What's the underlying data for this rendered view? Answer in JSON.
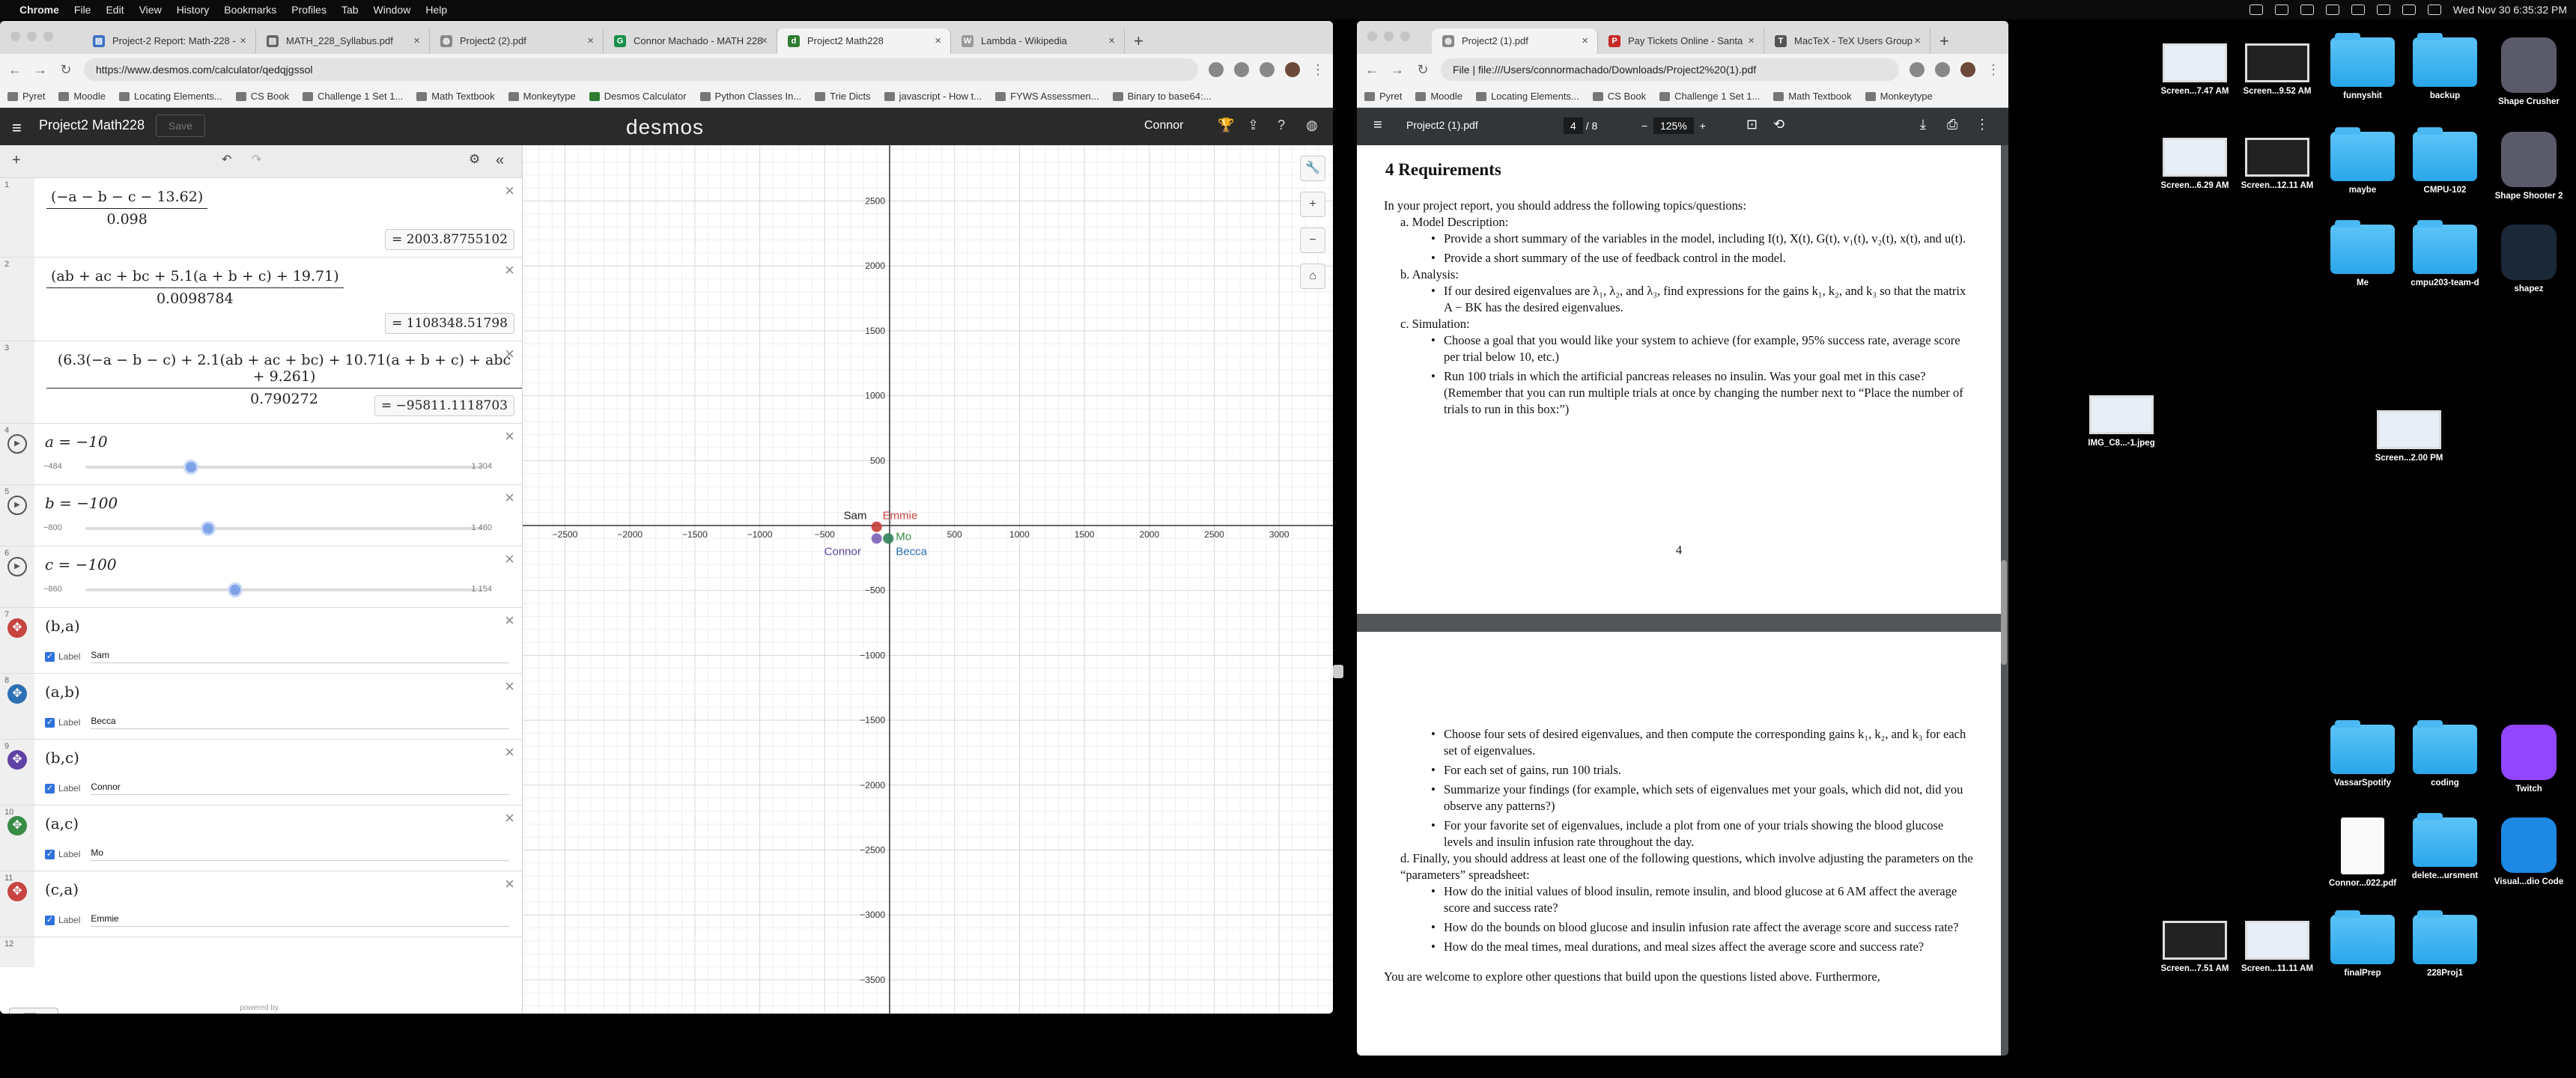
{
  "menubar": {
    "app": "Chrome",
    "menus": [
      "File",
      "Edit",
      "View",
      "History",
      "Bookmarks",
      "Profiles",
      "Tab",
      "Window",
      "Help"
    ],
    "clock": "Wed Nov 30  6:35:32 PM"
  },
  "chrome_left": {
    "tabs": [
      "Project-2 Report: Math-228 -",
      "MATH_228_Syllabus.pdf",
      "Project2 (2).pdf",
      "Connor Machado - MATH 228",
      "Project2 Math228",
      "Lambda - Wikipedia"
    ],
    "url": "https://www.desmos.com/calculator/qedqjgssol",
    "bookmarks": [
      "Pyret",
      "Moodle",
      "Locating Elements...",
      "CS Book",
      "Challenge 1 Set 1...",
      "Math Textbook",
      "Monkeytype",
      "Desmos Calculator",
      "Python Classes In...",
      "Trie Dicts",
      "javascript - How t...",
      "FYWS Assessmen...",
      "Binary to base64:..."
    ]
  },
  "desmos": {
    "menu_icon": "hamburger-icon",
    "title": "Project2 Math228",
    "save": "Save",
    "logo": "desmos",
    "user": "Connor",
    "powered1": "powered by",
    "powered2": "desmos",
    "expressions": [
      {
        "num": "1",
        "numerator": "(−a − b − c − 13.62)",
        "denominator": "0.098",
        "result": "= 2003.87755102"
      },
      {
        "num": "2",
        "numerator": "(ab + ac + bc + 5.1(a + b + c) + 19.71)",
        "denominator": "0.0098784",
        "result": "= 1108348.51798"
      },
      {
        "num": "3",
        "numerator": "(6.3(−a − b − c) + 2.1(ab + ac + bc) + 10.71(a + b + c) + abc + 9.261)",
        "denominator": "0.790272",
        "result": "= −95811.1118703"
      },
      {
        "num": "4",
        "eq": "a = −10",
        "min": "−484",
        "max": "1 304",
        "value": -10
      },
      {
        "num": "5",
        "eq": "b = −100",
        "min": "−800",
        "max": "1 460",
        "value": -100
      },
      {
        "num": "6",
        "eq": "c = −100",
        "min": "−860",
        "max": "1 154",
        "value": -100
      },
      {
        "num": "7",
        "point": "(b,a)",
        "label_word": "Label",
        "label": "Sam",
        "color": "#c74440"
      },
      {
        "num": "8",
        "point": "(a,b)",
        "label_word": "Label",
        "label": "Becca",
        "color": "#2d70b3"
      },
      {
        "num": "9",
        "point": "(b,c)",
        "label_word": "Label",
        "label": "Connor",
        "color": "#6042a6"
      },
      {
        "num": "10",
        "point": "(a,c)",
        "label_word": "Label",
        "label": "Mo",
        "color": "#388c46"
      },
      {
        "num": "11",
        "point": "(c,a)",
        "label_word": "Label",
        "label": "Emmie",
        "color": "#c74440"
      },
      {
        "num": "12"
      }
    ],
    "graph": {
      "x_ticks": [
        -2500,
        -2000,
        -1500,
        -1000,
        -500,
        500,
        1000,
        1500,
        2000,
        2500,
        3000
      ],
      "y_ticks": [
        2500,
        2000,
        1500,
        1000,
        500,
        -500,
        -1000,
        -1500,
        -2000,
        -2500,
        -3000,
        -3500
      ],
      "points": [
        {
          "name": "Sam",
          "x": -100,
          "y": -10,
          "color": "#c74440"
        },
        {
          "name": "Becca",
          "x": -10,
          "y": -100,
          "color": "#2d70b3"
        },
        {
          "name": "Connor",
          "x": -100,
          "y": -100,
          "color": "#6042a6"
        },
        {
          "name": "Mo",
          "x": -10,
          "y": -100,
          "color": "#388c46"
        },
        {
          "name": "Emmie",
          "x": -100,
          "y": -10,
          "color": "#c74440"
        }
      ]
    }
  },
  "chrome_right": {
    "tabs": [
      "Project2 (1).pdf",
      "Pay Tickets Online - Santa",
      "MacTeX - TeX Users Group"
    ],
    "url": "File  |  file:///Users/connormachado/Downloads/Project2%20(1).pdf",
    "bookmarks": [
      "Pyret",
      "Moodle",
      "Locating Elements...",
      "CS Book",
      "Challenge 1 Set 1...",
      "Math Textbook",
      "Monkeytype"
    ]
  },
  "pdf": {
    "title": "Project2 (1).pdf",
    "page": "4",
    "total": "/  8",
    "zoom": "125%",
    "heading": "4   Requirements",
    "intro": "In your project report, you should address the following topics/questions:",
    "a_title": "a.  Model Description:",
    "a_items": [
      "Provide a short summary of the variables in the model, including I(t), X(t), G(t), v₁(t), v₂(t), x(t), and u(t).",
      "Provide a short summary of the use of feedback control in the model."
    ],
    "b_title": "b.  Analysis:",
    "b_items": [
      "If our desired eigenvalues are λ₁, λ₂, and λ₃, find expressions for the gains k₁, k₂, and k₃ so that the matrix A − BK has the desired eigenvalues."
    ],
    "c_title": "c.  Simulation:",
    "c_items": [
      "Choose a goal that you would like your system to achieve (for example, 95% success rate, average score per trial below 10, etc.)",
      "Run 100 trials in which the artificial pancreas releases no insulin. Was your goal met in this case? (Remember that you can run multiple trials at once by changing the number next to “Place the number of trials to run in this box:”)"
    ],
    "page_number": "4",
    "c_items2": [
      "Choose four sets of desired eigenvalues, and then compute the corresponding gains k₁, k₂, and k₃ for each set of eigenvalues.",
      "For each set of gains, run 100 trials.",
      "Summarize your findings (for example, which sets of eigenvalues met your goals, which did not, did you observe any patterns?)",
      "For your favorite set of eigenvalues, include a plot from one of your trials showing the blood glucose levels and insulin infusion rate throughout the day."
    ],
    "d_title": "d.  Finally, you should address at least one of the following questions, which involve adjusting the parameters on the “parameters” spreadsheet:",
    "d_items": [
      "How do the initial values of blood insulin, remote insulin, and blood glucose at 6 AM affect the average score and success rate?",
      "How do the bounds on blood glucose and insulin infusion rate affect the average score and success rate?",
      "How do the meal times, meal durations, and meal sizes affect the average score and success rate?"
    ],
    "tail": "You are welcome to explore other questions that build upon the questions listed above. Furthermore,"
  },
  "desktop": [
    {
      "label": "Screen...7.47 AM",
      "kind": "shot"
    },
    {
      "label": "Screen...9.52 AM",
      "kind": "shotdark"
    },
    {
      "label": "funnyshit",
      "kind": "folder"
    },
    {
      "label": "backup",
      "kind": "folder"
    },
    {
      "label": "Shape Crusher",
      "kind": "app"
    },
    {
      "label": "Screen...6.29 AM",
      "kind": "shot"
    },
    {
      "label": "Screen...12.11 AM",
      "kind": "shotdark"
    },
    {
      "label": "maybe",
      "kind": "folder"
    },
    {
      "label": "CMPU-102",
      "kind": "folder"
    },
    {
      "label": "Shape Shooter 2",
      "kind": "app"
    },
    {
      "label": "Me",
      "kind": "folder"
    },
    {
      "label": "cmpu203-team-d",
      "kind": "folder"
    },
    {
      "label": "shapez",
      "kind": "app"
    },
    {
      "label": "IMG_C8...-1.jpeg",
      "kind": "shot"
    },
    {
      "label": "Screen...2.00 PM",
      "kind": "shot"
    },
    {
      "label": "VassarSpotify",
      "kind": "folder"
    },
    {
      "label": "coding",
      "kind": "folder"
    },
    {
      "label": "Twitch",
      "kind": "app"
    },
    {
      "label": "Connor...022.pdf",
      "kind": "pdf"
    },
    {
      "label": "delete...ursment",
      "kind": "folder"
    },
    {
      "label": "Visual...dio Code",
      "kind": "app"
    },
    {
      "label": "Screen...7.51 AM",
      "kind": "shotdark"
    },
    {
      "label": "Screen...11.11 AM",
      "kind": "shot"
    },
    {
      "label": "finalPrep",
      "kind": "folder"
    },
    {
      "label": "228Proj1",
      "kind": "folder"
    }
  ]
}
